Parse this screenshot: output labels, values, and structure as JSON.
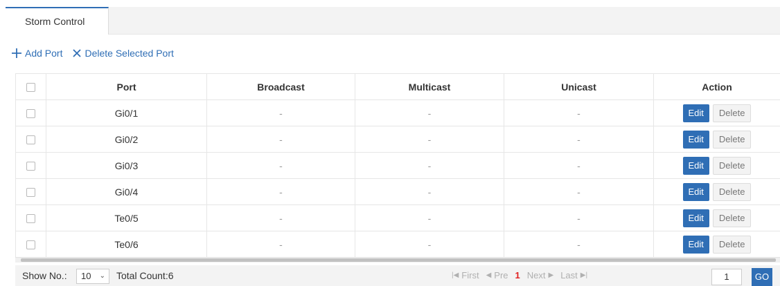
{
  "tabs": [
    {
      "label": "Storm Control",
      "active": true
    }
  ],
  "toolbar": {
    "add_label": "Add Port",
    "delete_label": "Delete Selected Port"
  },
  "table": {
    "headers": [
      "Port",
      "Broadcast",
      "Multicast",
      "Unicast",
      "Action"
    ],
    "rows": [
      {
        "port": "Gi0/1",
        "broadcast": "-",
        "multicast": "-",
        "unicast": "-",
        "edit": "Edit",
        "delete": "Delete"
      },
      {
        "port": "Gi0/2",
        "broadcast": "-",
        "multicast": "-",
        "unicast": "-",
        "edit": "Edit",
        "delete": "Delete"
      },
      {
        "port": "Gi0/3",
        "broadcast": "-",
        "multicast": "-",
        "unicast": "-",
        "edit": "Edit",
        "delete": "Delete"
      },
      {
        "port": "Gi0/4",
        "broadcast": "-",
        "multicast": "-",
        "unicast": "-",
        "edit": "Edit",
        "delete": "Delete"
      },
      {
        "port": "Te0/5",
        "broadcast": "-",
        "multicast": "-",
        "unicast": "-",
        "edit": "Edit",
        "delete": "Delete"
      },
      {
        "port": "Te0/6",
        "broadcast": "-",
        "multicast": "-",
        "unicast": "-",
        "edit": "Edit",
        "delete": "Delete"
      }
    ]
  },
  "footer": {
    "show_label": "Show No.:",
    "page_size": "10",
    "total": "Total Count:6",
    "first": "First",
    "pre": "Pre",
    "current_page": "1",
    "next": "Next",
    "last": "Last",
    "page_input": "1",
    "go": "GO"
  },
  "colors": {
    "accent": "#2f6eb5",
    "current_page": "#e02020",
    "disabled_text": "#b0b0b0"
  }
}
